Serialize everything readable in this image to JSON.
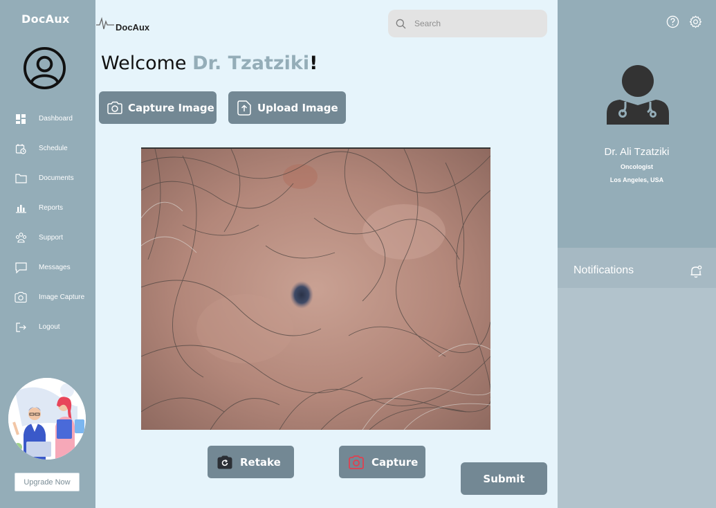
{
  "sidebar": {
    "brand": "DocAux",
    "items": [
      {
        "label": "Dashboard",
        "icon": "dashboard-icon"
      },
      {
        "label": "Schedule",
        "icon": "schedule-icon"
      },
      {
        "label": "Documents",
        "icon": "folder-icon"
      },
      {
        "label": "Reports",
        "icon": "bar-chart-icon"
      },
      {
        "label": "Support",
        "icon": "support-icon"
      },
      {
        "label": "Messages",
        "icon": "message-icon"
      },
      {
        "label": "Image Capture",
        "icon": "camera-icon"
      },
      {
        "label": "Logout",
        "icon": "logout-icon"
      }
    ],
    "upgrade_label": "Upgrade Now"
  },
  "header": {
    "logo_text": "DocAux",
    "search_placeholder": "Search"
  },
  "main": {
    "welcome_prefix": "Welcome ",
    "welcome_name": "Dr. Tzatziki",
    "welcome_suffix": "!",
    "capture_image_label": "Capture Image",
    "upload_image_label": "Upload Image",
    "retake_label": "Retake",
    "capture_label": "Capture",
    "submit_label": "Submit"
  },
  "profile": {
    "name": "Dr. Ali Tzatziki",
    "role": "Oncologist",
    "location": "Los Angeles, USA"
  },
  "notifications": {
    "title": "Notifications"
  },
  "colors": {
    "sidebar": "#94adb8",
    "main_bg": "#e6f4fb",
    "button": "#738894",
    "accent_red": "#e04050"
  }
}
